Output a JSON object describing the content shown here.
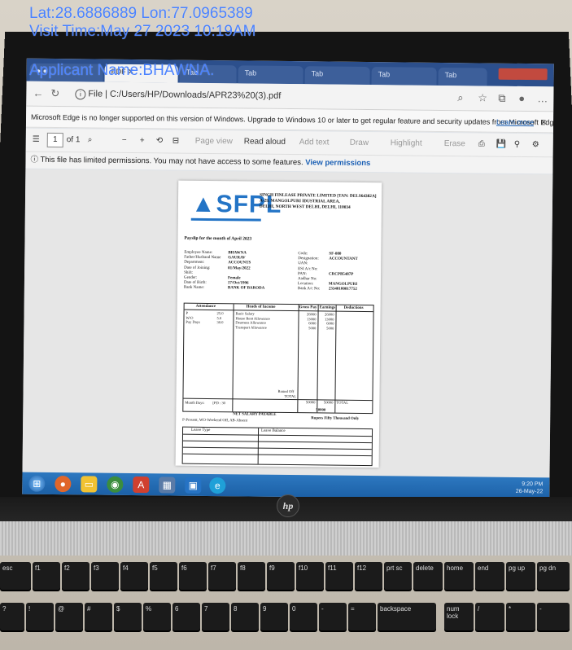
{
  "overlay": {
    "coords": "Lat:28.6886889 Lon:77.0965389",
    "visit_time": "Visit Time:May 27 2023 10:19AM",
    "applicant": "Applicant Name:BHAWNA."
  },
  "browser": {
    "url_label": "File",
    "url": "C:/Users/HP/Downloads/APR23%20(3).pdf",
    "warning": "Microsoft Edge is no longer supported on this version of Windows. Upgrade to Windows 10 or later to get regular feature and security updates from Microsoft Edge.",
    "learn_more": "Learn more",
    "page_current": "1",
    "page_total": "of 1",
    "page_view": "Page view",
    "read_aloud": "Read aloud",
    "add_text": "Add text",
    "draw": "Draw",
    "highlight": "Highlight",
    "erase": "Erase",
    "permission_msg": "This file has limited permissions. You may not have access to some features.",
    "view_permissions": "View permissions"
  },
  "payslip": {
    "logo": "SFPL",
    "company_line1": "SINGH FINLEASE PRIVATE LIMITED   [TAN: DELS64382A]",
    "company_line2": "A-29, MANGOLPURI IDUSTRIAL AREA,",
    "company_line3": "DELHI, NORTH WEST DELHI, DELHI, 110034",
    "payslip_for": "Payslip for the month of April 2023",
    "left_labels": [
      "Employee Name:",
      "Father/Husband Name",
      "Department:",
      "Date of Joining:",
      "Shift:",
      "Gender:",
      "Date of Birth:",
      "Bank Name:"
    ],
    "left_values": [
      "BHAWNA",
      "GAURAV",
      "ACCOUNTS",
      "01/May/2022",
      "",
      "Female",
      "17/Oct/1996",
      "BANK OF BARODA"
    ],
    "right_labels": [
      "Code:",
      "Designation:",
      "UAN:",
      "ESI A/c No:",
      "PAN:",
      "Aadhar No:",
      "Location:",
      "Bank A/c No:"
    ],
    "right_values": [
      "SF-080",
      "ACCOUNTANT",
      "",
      "",
      "CRCPB5487P",
      "",
      "MANGOLPURI",
      "23340100017752"
    ],
    "headers": [
      "Attendance",
      "Heads of Income",
      "Gross Pay",
      "Earnings",
      "Deductions"
    ],
    "attendance": [
      [
        "P",
        "25.0"
      ],
      [
        "W/O",
        "5.0"
      ],
      [
        "Pay Days",
        "30.0"
      ]
    ],
    "income": [
      {
        "head": "Basic Salary",
        "gross": "26000",
        "earn": "26000"
      },
      {
        "head": "House Rent Allowance",
        "gross": "13000",
        "earn": "13000"
      },
      {
        "head": "Dearness Allowance",
        "gross": "6000",
        "earn": "6000"
      },
      {
        "head": "Transport Allowance",
        "gross": "5000",
        "earn": "5000"
      }
    ],
    "round_off": "Round Off",
    "month_days_label": "Month Days:",
    "month_days_value": "[PD : 30",
    "total_label": "TOTAL",
    "total_gross": "50000",
    "total_earn": "50000",
    "total_ded": "TOTAL",
    "net_label": "NET SALARY PAYABLE",
    "net_value": "50000",
    "in_words": "Rupees Fifty Thousand Only",
    "legend": "P-Present, WO-Weekend Off, AB-Absent",
    "leave_type": "Leave Type",
    "leave_balance": "Leave Balance"
  },
  "taskbar": {
    "time": "9:20 PM",
    "date": "26-May-22"
  },
  "laptop": {
    "brand": "hp",
    "keys_row1": [
      "esc",
      "f1",
      "f2",
      "f3",
      "f4",
      "f5",
      "f6",
      "f7",
      "f8",
      "f9",
      "f10",
      "f11",
      "f12",
      "prt sc",
      "delete",
      "home",
      "end",
      "pg up",
      "pg dn"
    ],
    "keys_row2": [
      "?",
      "!",
      "@",
      "#",
      "$",
      "%",
      "6",
      "7",
      "8",
      "9",
      "0",
      "-",
      "=",
      "backspace",
      "num lock",
      "/",
      "*",
      "-"
    ]
  }
}
